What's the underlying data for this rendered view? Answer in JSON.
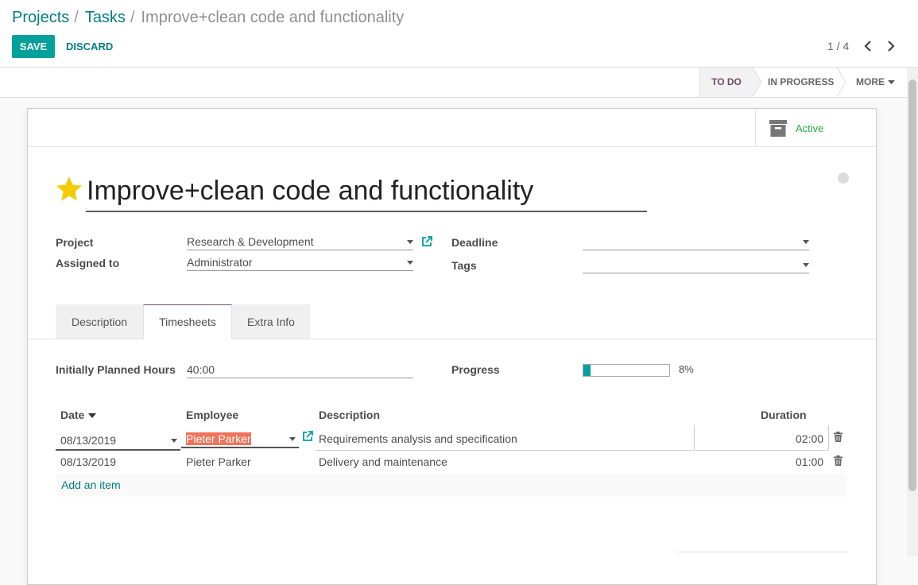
{
  "breadcrumb": {
    "projects": "Projects",
    "tasks": "Tasks",
    "separator": "/",
    "current": "Improve+clean code and functionality"
  },
  "toolbar": {
    "save_label": "SAVE",
    "discard_label": "DISCARD"
  },
  "pager": {
    "value": "1 / 4"
  },
  "statusbar": {
    "stage_todo": "TO DO",
    "stage_inprogress": "IN PROGRESS",
    "more_label": "MORE"
  },
  "archive": {
    "label": "Active"
  },
  "task": {
    "title": "Improve+clean code and functionality",
    "starred": true,
    "project_label": "Project",
    "project_value": "Research & Development",
    "assigned_label": "Assigned to",
    "assigned_value": "Administrator",
    "deadline_label": "Deadline",
    "deadline_value": "",
    "tags_label": "Tags",
    "tags_value": ""
  },
  "tabs": [
    "Description",
    "Timesheets",
    "Extra Info"
  ],
  "timesheets": {
    "planned_label": "Initially Planned Hours",
    "planned_value": "40:00",
    "progress_label": "Progress",
    "progress_value": "8%",
    "progress_fraction": 0.08,
    "columns": {
      "date": "Date",
      "employee": "Employee",
      "description": "Description",
      "duration": "Duration"
    },
    "rows": [
      {
        "date": "08/13/2019",
        "employee": "Pieter Parker",
        "description": "Requirements analysis and specification",
        "duration": "02:00"
      },
      {
        "date": "08/13/2019",
        "employee": "Pieter Parker",
        "description": "Delivery and maintenance",
        "duration": "01:00"
      }
    ],
    "add_item": "Add an item"
  },
  "colors": {
    "primary": "#00a09d",
    "link": "#017e84",
    "brand": "#714b67",
    "highlight": "#f0735a",
    "active": "#28a745",
    "star": "#f3cc00"
  }
}
